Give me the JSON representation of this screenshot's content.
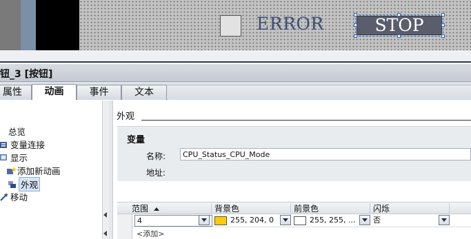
{
  "canvas": {
    "error_text": "ERROR",
    "stop_button": "STOP"
  },
  "inspector": {
    "title": "钮_3 [按钮]"
  },
  "tabs": [
    {
      "label": "属性",
      "active": false
    },
    {
      "label": "动画",
      "active": true
    },
    {
      "label": "事件",
      "active": false
    },
    {
      "label": "文本",
      "active": false
    }
  ],
  "tree": {
    "overview": "总览",
    "var_connect": "变量连接",
    "display": "显示",
    "add_animation": "添加新动画",
    "appearance": "外观",
    "move": "移动"
  },
  "section": {
    "title": "外观"
  },
  "variable": {
    "title": "变量",
    "name_label": "名称:",
    "name_value": "CPU_Status_CPU_Mode",
    "address_label": "地址:"
  },
  "grid": {
    "headers": [
      "范围",
      "背景色",
      "前景色",
      "闪烁"
    ],
    "rows": [
      {
        "range": "4",
        "bg_color_text": "255, 204, 0",
        "bg_color_hex": "#ffcc00",
        "fg_color_text": "255, 255, ...",
        "fg_color_hex": "#ffffff",
        "blink": "否"
      }
    ],
    "add_label": "<添加>"
  }
}
